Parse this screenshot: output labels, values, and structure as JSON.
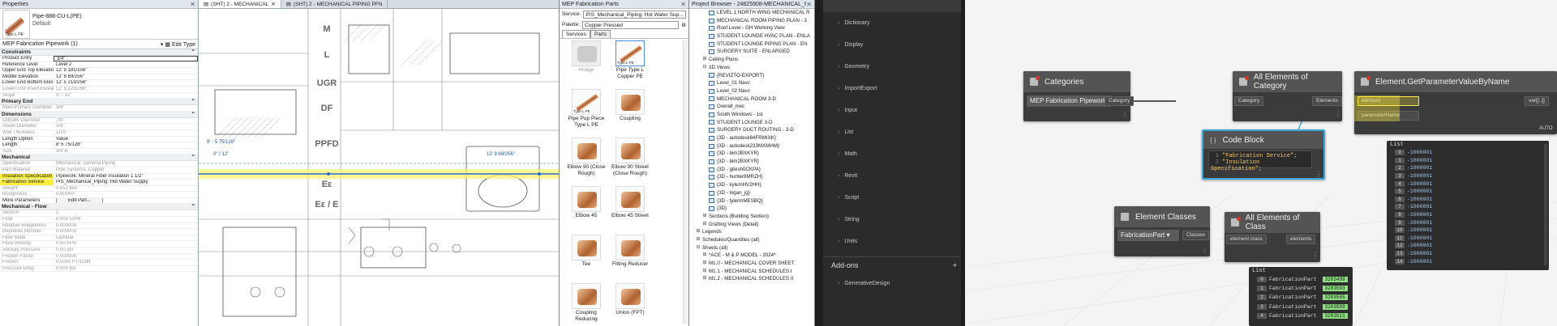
{
  "properties": {
    "title": "Properties",
    "type_name": "Pipe-888-CU-L(PE)",
    "type_sub": "Default",
    "thumb_caption": "Type L PE",
    "instance_label": "MEP Fabrication Pipework (1)",
    "edit_type": "Edit Type",
    "groups": [
      {
        "name": "Constraints",
        "rows": [
          {
            "k": "Product Entry",
            "v": "3/4\"",
            "style": "boxed"
          },
          {
            "k": "Reference Level",
            "v": "Level 2"
          },
          {
            "k": "Upper End Top Elevation",
            "v": "12' 9 181/256\""
          },
          {
            "k": "Middle Elevation",
            "v": "12' 8 69/256\""
          },
          {
            "k": "Lower End Bottom Elevati...",
            "v": "12' 5 213/256\""
          },
          {
            "k": "Lower End Invert Elevation",
            "v": "12' 5 229/256\"",
            "style": "dim"
          },
          {
            "k": "Slope",
            "v": "0\" / 12\"",
            "style": "dim"
          }
        ]
      },
      {
        "name": "Primary End",
        "rows": [
          {
            "k": "Main Primary Diameter",
            "v": "3/4\"",
            "style": "dim"
          }
        ]
      },
      {
        "name": "Dimensions",
        "rows": [
          {
            "k": "Outside Diameter",
            "v": "7/8\"",
            "style": "dim"
          },
          {
            "k": "Inside Diameter",
            "v": "3/4\"",
            "style": "dim"
          },
          {
            "k": "Wall Thickness",
            "v": "1/16\"",
            "style": "dim"
          },
          {
            "k": "Length Option",
            "v": "Value"
          },
          {
            "k": "Length",
            "v": "8' 5 75/128\""
          },
          {
            "k": "Size",
            "v": "3/4\"ø",
            "style": "dim"
          }
        ]
      },
      {
        "name": "Mechanical",
        "rows": [
          {
            "k": "Specification",
            "v": "Mechanical: General Piping",
            "style": "dim"
          },
          {
            "k": "Part Material",
            "v": "Pipe Systems: Copper",
            "style": "dim"
          },
          {
            "k": "Insulation Specification",
            "v": "Pipework: Mineral Fiber Insulation 1 1/2\"",
            "style": "hl"
          },
          {
            "k": "Fabrication Service",
            "v": "PIS_Mechanical_Piping: Hot Water Supply",
            "style": "hl"
          },
          {
            "k": "Weight",
            "v": "3.852 lbm",
            "style": "dim"
          },
          {
            "k": "Roughness",
            "v": "0.00000\"",
            "style": "dim"
          },
          {
            "k": "More Parameters",
            "v": "Edit Part...",
            "style": "btn"
          }
        ]
      },
      {
        "name": "Mechanical - Flow",
        "rows": [
          {
            "k": "Section",
            "v": "1",
            "style": "dim"
          },
          {
            "k": "Flow",
            "v": "0.000 GPM",
            "style": "dim"
          },
          {
            "k": "Relative Roughness",
            "v": "0.000000",
            "style": "dim"
          },
          {
            "k": "Reynolds Number",
            "v": "0.000000",
            "style": "dim"
          },
          {
            "k": "Flow State",
            "v": "Laminar",
            "style": "dim"
          },
          {
            "k": "Fluid Velocity",
            "v": "0.00 FPS",
            "style": "dim"
          },
          {
            "k": "Velocity Pressure",
            "v": "0.00 psi",
            "style": "dim"
          },
          {
            "k": "Friction Factor",
            "v": "0.000000",
            "style": "dim"
          },
          {
            "k": "Friction",
            "v": "0.0000 FT/100ft",
            "style": "dim"
          },
          {
            "k": "Pressure Drop",
            "v": "0.000 psi",
            "style": "dim"
          }
        ]
      }
    ]
  },
  "drawing": {
    "tabs": [
      "(SHT) 2 - MECHANICAL",
      "(SHT) 2 - MECHANICAL PIPING PFN"
    ],
    "grid_labels": [
      "M",
      "L",
      "UGR",
      "DF",
      "PPFD",
      "Eε",
      "Eε / E"
    ],
    "dim1": "8' - 5 75/128\"",
    "dim2": "0\" / 12\"",
    "dim3": "12' 8 69/256\""
  },
  "mep": {
    "title": "MEP Fabrication Parts",
    "service_label": "Service:",
    "service_value": "PIS_Mechanical_Piping: Hot Water Sup...",
    "palette_label": "Palette:",
    "palette_value": "Copper Pressed",
    "tabs": [
      "Services",
      "Parts"
    ],
    "parts": [
      {
        "name": "Hnage",
        "kind": "ghost"
      },
      {
        "name": "Pipe Type L Copper PE",
        "kind": "bar",
        "thumb_caption": "Type L PE"
      },
      {
        "name": "Pipe Pup Piece Type L PE",
        "kind": "bar",
        "thumb_caption": "Type L PE"
      },
      {
        "name": "Coupling",
        "kind": "shape"
      },
      {
        "name": "Elbow 90 (Close Rough)",
        "kind": "shape"
      },
      {
        "name": "Elbow 90 Street (Close Rough)",
        "kind": "shape"
      },
      {
        "name": "Elbow 45",
        "kind": "shape"
      },
      {
        "name": "Elbow 45 Street",
        "kind": "shape"
      },
      {
        "name": "Tee",
        "kind": "shape"
      },
      {
        "name": "Fitting Reducer",
        "kind": "shape"
      },
      {
        "name": "Coupling Reducing",
        "kind": "shape"
      },
      {
        "name": "Union (FPT)",
        "kind": "shape"
      }
    ]
  },
  "browser": {
    "title": "Project Browser - 24825908-MECHANICAL_R24_aut...",
    "items": [
      {
        "t": "LEVEL 1 NORTH WING MECHANICAL R",
        "lvl": 3,
        "ic": true
      },
      {
        "t": "MECHANICAL ROOM PIPING PLAN - 3",
        "lvl": 3,
        "ic": true
      },
      {
        "t": "Roof Level - GH Working View",
        "lvl": 3,
        "ic": true
      },
      {
        "t": "STUDENT LOUNGE HVAC PLAN - ENLA",
        "lvl": 3,
        "ic": true
      },
      {
        "t": "STUDENT LOUNGE PIPING PLAN - EN",
        "lvl": 3,
        "ic": true
      },
      {
        "t": "SURGERY SUITE - ENLARGED",
        "lvl": 3,
        "ic": true
      },
      {
        "t": "Ceiling Plans",
        "lvl": 2,
        "exp": "+"
      },
      {
        "t": "3D Views",
        "lvl": 2,
        "exp": "−"
      },
      {
        "t": "{REVIZTO-EXPORT}",
        "lvl": 3,
        "ic": true
      },
      {
        "t": "Level_01 Navc",
        "lvl": 3,
        "ic": true
      },
      {
        "t": "Level_02 Navc",
        "lvl": 3,
        "ic": true
      },
      {
        "t": "MECHANICAL ROOM 3-D",
        "lvl": 3,
        "ic": true
      },
      {
        "t": "Overall_nwc",
        "lvl": 3,
        "ic": true
      },
      {
        "t": "South Windows - 1st",
        "lvl": 3,
        "ic": true
      },
      {
        "t": "STUDENT LOUNGE 3-D",
        "lvl": 3,
        "ic": true
      },
      {
        "t": "SURGERY DUCT ROUTING - 3-D",
        "lvl": 3,
        "ic": true
      },
      {
        "t": "{3D - autodesk84FRMIXK}",
        "lvl": 3,
        "ic": true
      },
      {
        "t": "{3D - autodesk233MXMHM}",
        "lvl": 3,
        "ic": true
      },
      {
        "t": "{3D - bim2BXKYR}",
        "lvl": 3,
        "ic": true
      },
      {
        "t": "{3D - bim2BXKYR}",
        "lvl": 3,
        "ic": true
      },
      {
        "t": "{3D - gitesh0CKPA}",
        "lvl": 3,
        "ic": true
      },
      {
        "t": "{3D - hunter8MRZH}",
        "lvl": 3,
        "ic": true
      },
      {
        "t": "{3D - kylemHV2HH}",
        "lvl": 3,
        "ic": true
      },
      {
        "t": "{3D - logan_jg}",
        "lvl": 3,
        "ic": true
      },
      {
        "t": "{3D - tylermMESBQ}",
        "lvl": 3,
        "ic": true
      },
      {
        "t": "{3D}",
        "lvl": 3,
        "ic": true
      },
      {
        "t": "Sections (Building Section)",
        "lvl": 2,
        "exp": "+"
      },
      {
        "t": "Drafting Views (Detail)",
        "lvl": 2,
        "exp": "+"
      },
      {
        "t": "Legends",
        "lvl": 1,
        "exp": "+"
      },
      {
        "t": "Schedules/Quantities (all)",
        "lvl": 1,
        "exp": "+"
      },
      {
        "t": "Sheets (all)",
        "lvl": 1,
        "exp": "−"
      },
      {
        "t": "*ACE - M & P MODEL - 2024*",
        "lvl": 2,
        "exp": "+"
      },
      {
        "t": "M1.0 - MECHANICAL COVER SHEET",
        "lvl": 2,
        "exp": "+"
      },
      {
        "t": "M1.1 - MECHANICAL SCHEDULES I",
        "lvl": 2,
        "exp": "+"
      },
      {
        "t": "M1.2 - MECHANICAL SCHEDULES II",
        "lvl": 2,
        "exp": "+"
      }
    ]
  },
  "library": {
    "items": [
      "Dictionary",
      "Display",
      "Geometry",
      "ImportExport",
      "Input",
      "List",
      "Math",
      "Revit",
      "Script",
      "String",
      "Units"
    ],
    "addons": "Add-ons",
    "addons_plus": "+",
    "addon_items": [
      "GenerativeDesign"
    ]
  },
  "canvas": {
    "categories": {
      "title": "Categories",
      "value": "MEP Fabrication Pipework",
      "out": "Category"
    },
    "all_elements": {
      "title": "All Elements of Category",
      "in": "Category",
      "out": "Elements"
    },
    "get_param": {
      "title": "Element.GetParameterValueByName",
      "in1": "element",
      "in2": "parameterName",
      "out": "var[]..[]",
      "lacing": "AUTO"
    },
    "code_block": {
      "title": "Code Block",
      "lines": [
        "\"Fabrication Service\";",
        "\"Insulation Specification\";"
      ]
    },
    "element_classes": {
      "title": "Element Classes",
      "value": "FabricationPart",
      "out": "Classes"
    },
    "all_of_class": {
      "title": "All Elements of Class",
      "in": "element class",
      "out": "elements"
    },
    "list_left": {
      "header": "List",
      "rows": [
        {
          "i": "0",
          "label": "FabricationPart",
          "id": "3283499"
        },
        {
          "i": "1",
          "label": "FabricationPart",
          "id": "3283503"
        },
        {
          "i": "2",
          "label": "FabricationPart",
          "id": "3283505"
        },
        {
          "i": "3",
          "label": "FabricationPart",
          "id": "3283509"
        },
        {
          "i": "4",
          "label": "FabricationPart",
          "id": "3283511"
        }
      ]
    },
    "list_right": {
      "header": "List",
      "rows": [
        {
          "i": "0",
          "v": "-1000001"
        },
        {
          "i": "1",
          "v": "-1000001"
        },
        {
          "i": "2",
          "v": "-1000001"
        },
        {
          "i": "3",
          "v": "-1000001"
        },
        {
          "i": "4",
          "v": "-1000001"
        },
        {
          "i": "5",
          "v": "-1000001"
        },
        {
          "i": "6",
          "v": "-1000001"
        },
        {
          "i": "7",
          "v": "-1000001"
        },
        {
          "i": "8",
          "v": "-1000001"
        },
        {
          "i": "9",
          "v": "-1000001"
        },
        {
          "i": "10",
          "v": "-1000001"
        },
        {
          "i": "11",
          "v": "-1000001"
        },
        {
          "i": "12",
          "v": "-1000001"
        },
        {
          "i": "13",
          "v": "-1000001"
        },
        {
          "i": "14",
          "v": "-1000001"
        }
      ]
    }
  }
}
